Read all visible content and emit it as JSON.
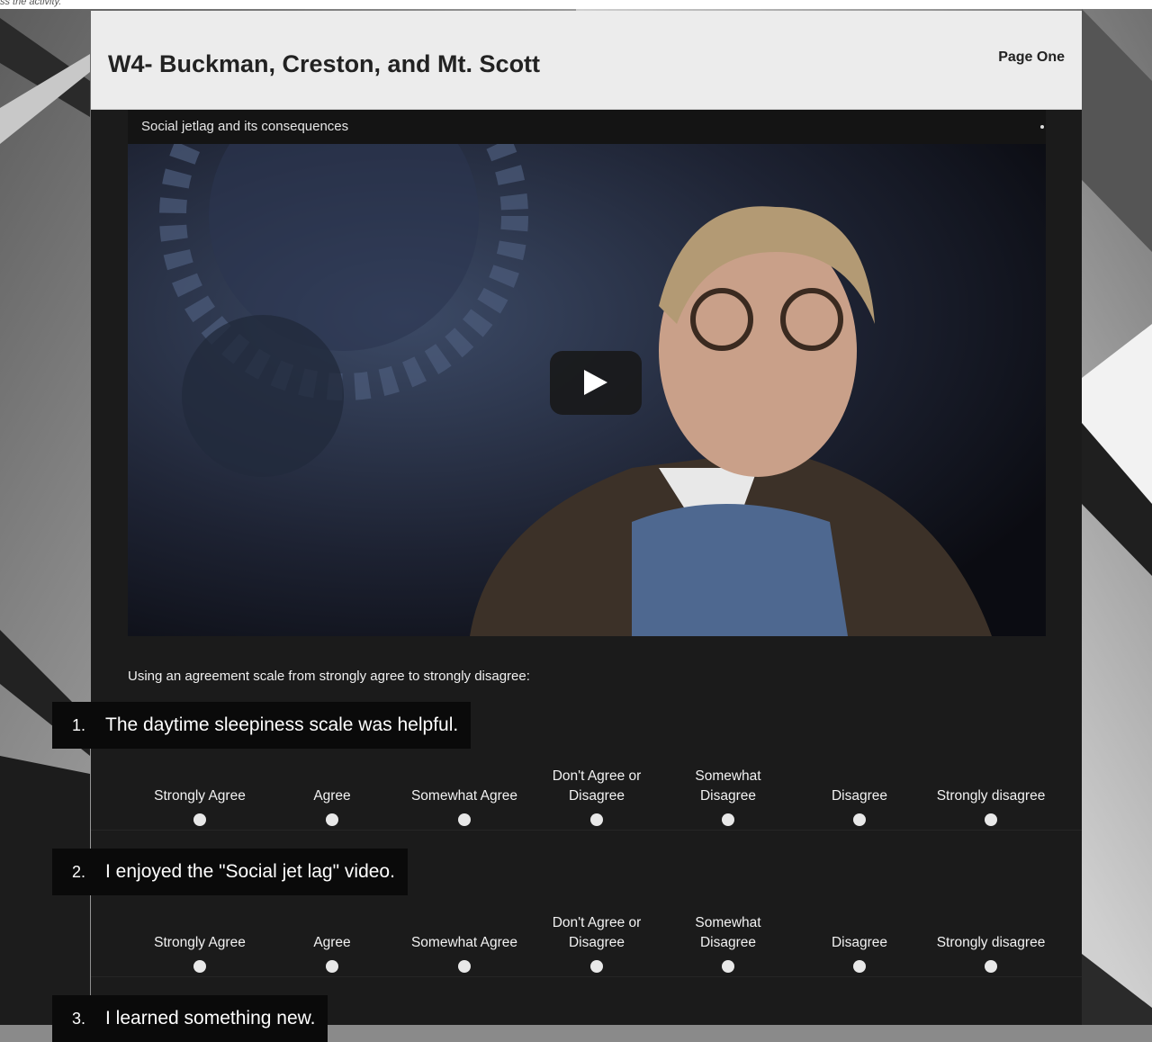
{
  "top_note": "ss the activity.",
  "header": {
    "title": "W4- Buckman, Creston, and Mt. Scott",
    "page_label": "Page One"
  },
  "video": {
    "title": "Social jetlag and its consequences"
  },
  "instructions": "Using an agreement scale from strongly agree to strongly disagree:",
  "scale_options": [
    "Strongly Agree",
    "Agree",
    "Somewhat Agree",
    "Don't Agree or Disagree",
    "Somewhat Disagree",
    "Disagree",
    "Strongly disagree"
  ],
  "questions": [
    {
      "number": "1.",
      "text": "The daytime sleepiness scale was helpful."
    },
    {
      "number": "2.",
      "text": "I enjoyed the \"Social jet lag\" video."
    },
    {
      "number": "3.",
      "text": "I learned something new."
    }
  ]
}
